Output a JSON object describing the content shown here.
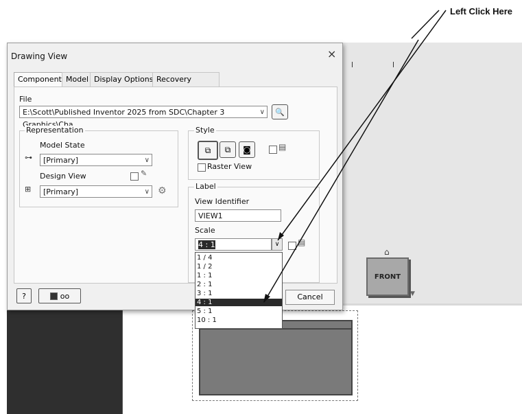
{
  "callout": {
    "text": "Left Click Here"
  },
  "dialog": {
    "title": "Drawing View",
    "close_glyph": "×",
    "tabs": [
      {
        "label": "Component",
        "active": true
      },
      {
        "label": "Model",
        "active": false
      },
      {
        "label": "Display Options",
        "active": false
      },
      {
        "label": "Recovery Options",
        "active": false
      }
    ],
    "file": {
      "label": "File",
      "path": "E:\\Scott\\Published Inventor 2025 from SDC\\Chapter 3 Graphics\\Cha"
    },
    "representation": {
      "label": "Representation",
      "model_state_label": "Model State",
      "model_state_value": "[Primary]",
      "design_view_label": "Design View",
      "design_view_value": "[Primary]"
    },
    "style": {
      "label": "Style",
      "raster_view_label": "Raster View"
    },
    "label_group": {
      "label": "Label",
      "view_identifier_label": "View Identifier",
      "view_identifier_value": "VIEW1",
      "scale_label": "Scale",
      "scale_value": "4 : 1"
    },
    "scale_options": [
      "1 / 4",
      "1 / 2",
      "1 : 1",
      "2 : 1",
      "3 : 1",
      "4 : 1",
      "5 : 1",
      "10 : 1"
    ],
    "selected_scale_index": 5,
    "cancel_label": "Cancel"
  },
  "background": {
    "view_cube_label": "FRONT"
  },
  "colors": {
    "selection": "#2a2a2a",
    "dialog_bg": "#f0f0f0"
  }
}
